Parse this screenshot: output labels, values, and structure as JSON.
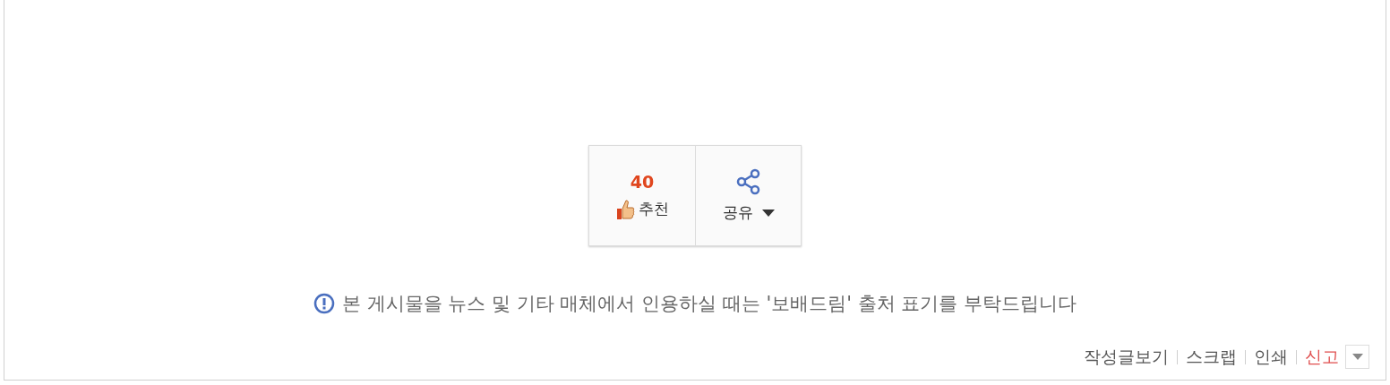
{
  "actions": {
    "recommend": {
      "count": "40",
      "label": "추천"
    },
    "share": {
      "label": "공유"
    }
  },
  "notice": "본 게시물을 뉴스 및 기타 매체에서 인용하실 때는 '보배드림' 출처 표기를 부탁드립니다",
  "links": [
    {
      "label": "작성글보기",
      "kind": "plain"
    },
    {
      "label": "스크랩",
      "kind": "plain"
    },
    {
      "label": "인쇄",
      "kind": "plain"
    },
    {
      "label": "신고",
      "kind": "alert"
    }
  ]
}
